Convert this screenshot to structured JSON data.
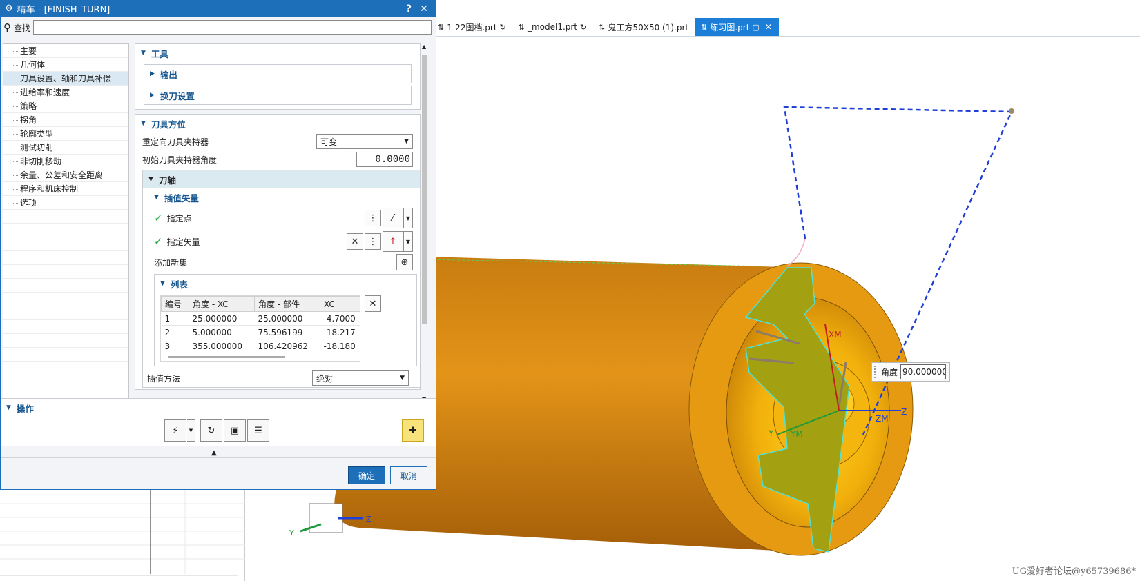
{
  "dialog": {
    "title": "精车 - [FINISH_TURN]",
    "help_icon": "?",
    "close_icon": "✕",
    "find_label": "查找",
    "find_value": ""
  },
  "tree": {
    "items": [
      {
        "label": "主要"
      },
      {
        "label": "几何体"
      },
      {
        "label": "刀具设置、轴和刀具补偿",
        "selected": true
      },
      {
        "label": "进给率和速度"
      },
      {
        "label": "策略"
      },
      {
        "label": "拐角"
      },
      {
        "label": "轮廓类型"
      },
      {
        "label": "测试切削"
      },
      {
        "label": "非切削移动",
        "expandable": true
      },
      {
        "label": "余量、公差和安全距离"
      },
      {
        "label": "程序和机床控制"
      },
      {
        "label": "选项"
      }
    ]
  },
  "tool_group": {
    "title": "工具",
    "sub": [
      {
        "label": "输出"
      },
      {
        "label": "换刀设置"
      }
    ]
  },
  "orient_group": {
    "title": "刀具方位",
    "reorient_label": "重定向刀具夹持器",
    "reorient_value": "可变",
    "initial_angle_label": "初始刀具夹持器角度",
    "initial_angle_value": "0.0000"
  },
  "axis_group": {
    "title": "刀轴",
    "interp_title": "插值矢量",
    "specify_point": "指定点",
    "specify_vector": "指定矢量",
    "add_set": "添加新集",
    "list_title": "列表",
    "columns": [
      "编号",
      "角度 - XC",
      "角度 - 部件",
      "XC"
    ],
    "rows": [
      [
        "1",
        "25.000000",
        "25.000000",
        "-4.7000"
      ],
      [
        "2",
        "5.000000",
        "75.596199",
        "-18.217"
      ],
      [
        "3",
        "355.000000",
        "106.420962",
        "-18.180"
      ]
    ],
    "interp_method_label": "插值方法",
    "interp_method_value": "绝对"
  },
  "operations": {
    "title": "操作"
  },
  "footer": {
    "ok": "确定",
    "cancel": "取消"
  },
  "tabs": [
    {
      "label": "1-22图档.prt",
      "active": false
    },
    {
      "label": "_model1.prt",
      "active": false
    },
    {
      "label": "鬼工方50X50 (1).prt",
      "active": false
    },
    {
      "label": "练习图.prt",
      "active": true
    }
  ],
  "viewport": {
    "angle_label": "角度",
    "angle_value": "90.000000",
    "axis_labels": {
      "xm": "XM",
      "ym": "YM",
      "zm": "ZM",
      "z": "Z",
      "y": "Y"
    },
    "triad": {
      "y": "Y",
      "z": "Z"
    },
    "watermark": "UG爱好者论坛@y65739686*"
  }
}
